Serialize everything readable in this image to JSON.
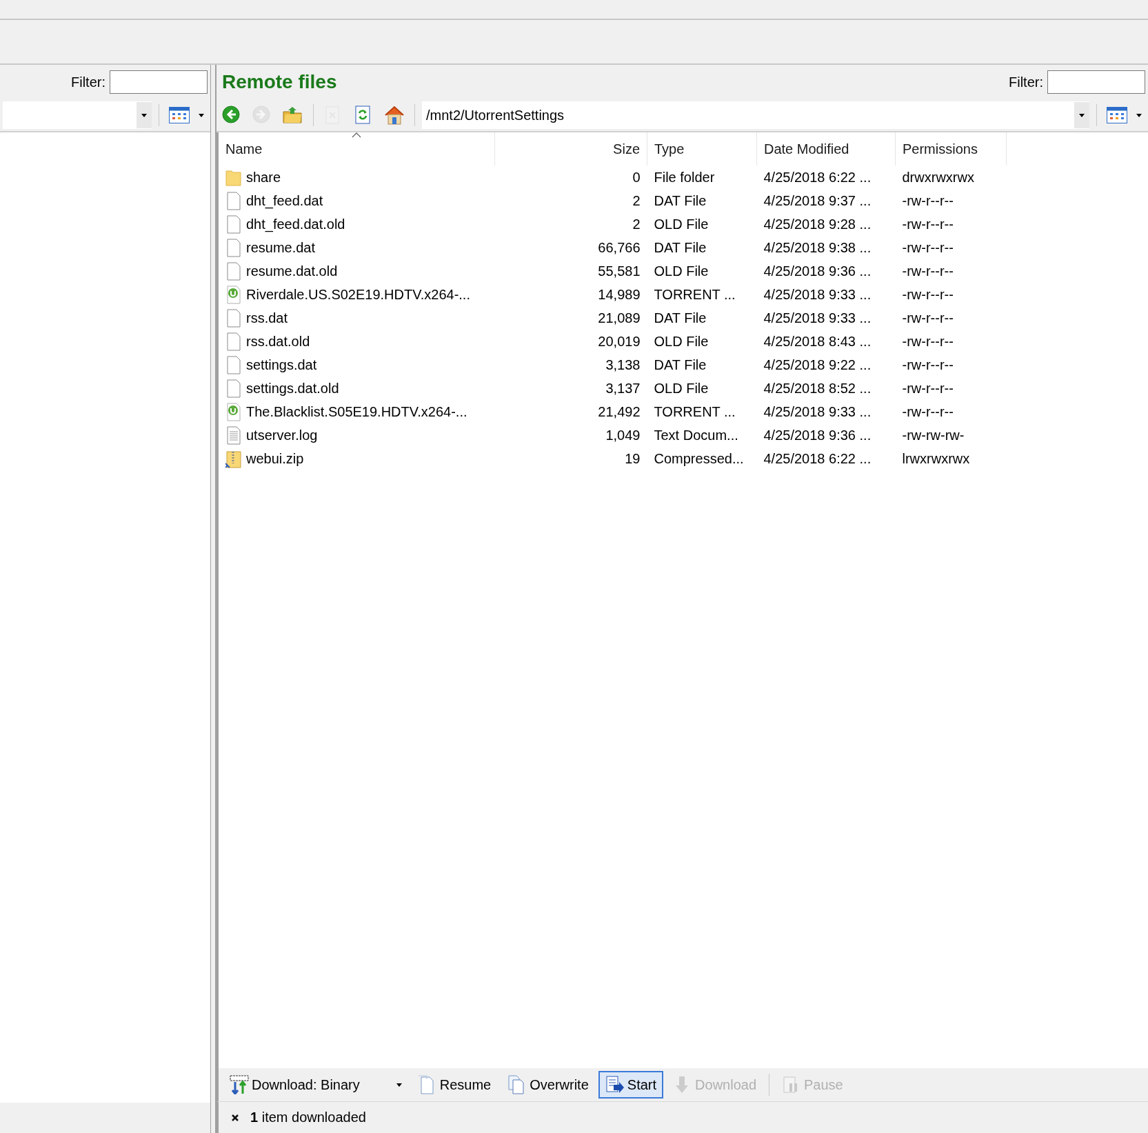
{
  "local_panel": {
    "filter": {
      "label": "Filter:"
    }
  },
  "remote_panel": {
    "title": "Remote files",
    "filter": {
      "label": "Filter:"
    },
    "toolbar": [
      {
        "kind": "back",
        "disabled": false
      },
      {
        "kind": "forward",
        "disabled": true
      },
      {
        "kind": "folder-up",
        "disabled": false
      },
      {
        "kind": "delete",
        "disabled": true
      },
      {
        "kind": "refresh",
        "disabled": false
      },
      {
        "kind": "home",
        "disabled": false
      }
    ],
    "path": "/mnt2/UtorrentSettings",
    "table": {
      "columns": [
        {
          "label": "Name",
          "sorted": true
        },
        {
          "label": "Size",
          "sorted": false
        },
        {
          "label": "Type",
          "sorted": false
        },
        {
          "label": "Date Modified",
          "sorted": false
        },
        {
          "label": "Permissions",
          "sorted": false
        }
      ],
      "rows": [
        {
          "kind": "folder",
          "cells": [
            "share",
            "0",
            "File folder",
            "4/25/2018 6:22 ...",
            "drwxrwxrwx"
          ]
        },
        {
          "kind": "file",
          "cells": [
            "dht_feed.dat",
            "2",
            "DAT File",
            "4/25/2018 9:37 ...",
            "-rw-r--r--"
          ]
        },
        {
          "kind": "file",
          "cells": [
            "dht_feed.dat.old",
            "2",
            "OLD File",
            "4/25/2018 9:28 ...",
            "-rw-r--r--"
          ]
        },
        {
          "kind": "file",
          "cells": [
            "resume.dat",
            "66,766",
            "DAT File",
            "4/25/2018 9:38 ...",
            "-rw-r--r--"
          ]
        },
        {
          "kind": "file",
          "cells": [
            "resume.dat.old",
            "55,581",
            "OLD File",
            "4/25/2018 9:36 ...",
            "-rw-r--r--"
          ]
        },
        {
          "kind": "torrent",
          "cells": [
            "Riverdale.US.S02E19.HDTV.x264-...",
            "14,989",
            "TORRENT ...",
            "4/25/2018 9:33 ...",
            "-rw-r--r--"
          ]
        },
        {
          "kind": "file",
          "cells": [
            "rss.dat",
            "21,089",
            "DAT File",
            "4/25/2018 9:33 ...",
            "-rw-r--r--"
          ]
        },
        {
          "kind": "file",
          "cells": [
            "rss.dat.old",
            "20,019",
            "OLD File",
            "4/25/2018 8:43 ...",
            "-rw-r--r--"
          ]
        },
        {
          "kind": "file",
          "cells": [
            "settings.dat",
            "3,138",
            "DAT File",
            "4/25/2018 9:22 ...",
            "-rw-r--r--"
          ]
        },
        {
          "kind": "file",
          "cells": [
            "settings.dat.old",
            "3,137",
            "OLD File",
            "4/25/2018 8:52 ...",
            "-rw-r--r--"
          ]
        },
        {
          "kind": "torrent",
          "cells": [
            "The.Blacklist.S05E19.HDTV.x264-...",
            "21,492",
            "TORRENT ...",
            "4/25/2018 9:33 ...",
            "-rw-r--r--"
          ]
        },
        {
          "kind": "text",
          "cells": [
            "utserver.log",
            "1,049",
            "Text Docum...",
            "4/25/2018 9:36 ...",
            "-rw-rw-rw-"
          ]
        },
        {
          "kind": "zip",
          "cells": [
            "webui.zip",
            "19",
            "Compressed...",
            "4/25/2018 6:22 ...",
            "lrwxrwxrwx"
          ]
        }
      ]
    }
  },
  "transfer_bar": [
    {
      "kind": "mode",
      "label": "Download: Binary",
      "selected": false,
      "disabled": false
    },
    {
      "kind": "resume",
      "label": "Resume",
      "selected": false,
      "disabled": false
    },
    {
      "kind": "overwrite",
      "label": "Overwrite",
      "selected": false,
      "disabled": false
    },
    {
      "kind": "start",
      "label": "Start",
      "selected": true,
      "disabled": false
    },
    {
      "kind": "download",
      "label": "Download",
      "selected": false,
      "disabled": true
    },
    {
      "kind": "pause",
      "label": "Pause",
      "selected": false,
      "disabled": true
    }
  ],
  "status": "**1** item downloaded"
}
